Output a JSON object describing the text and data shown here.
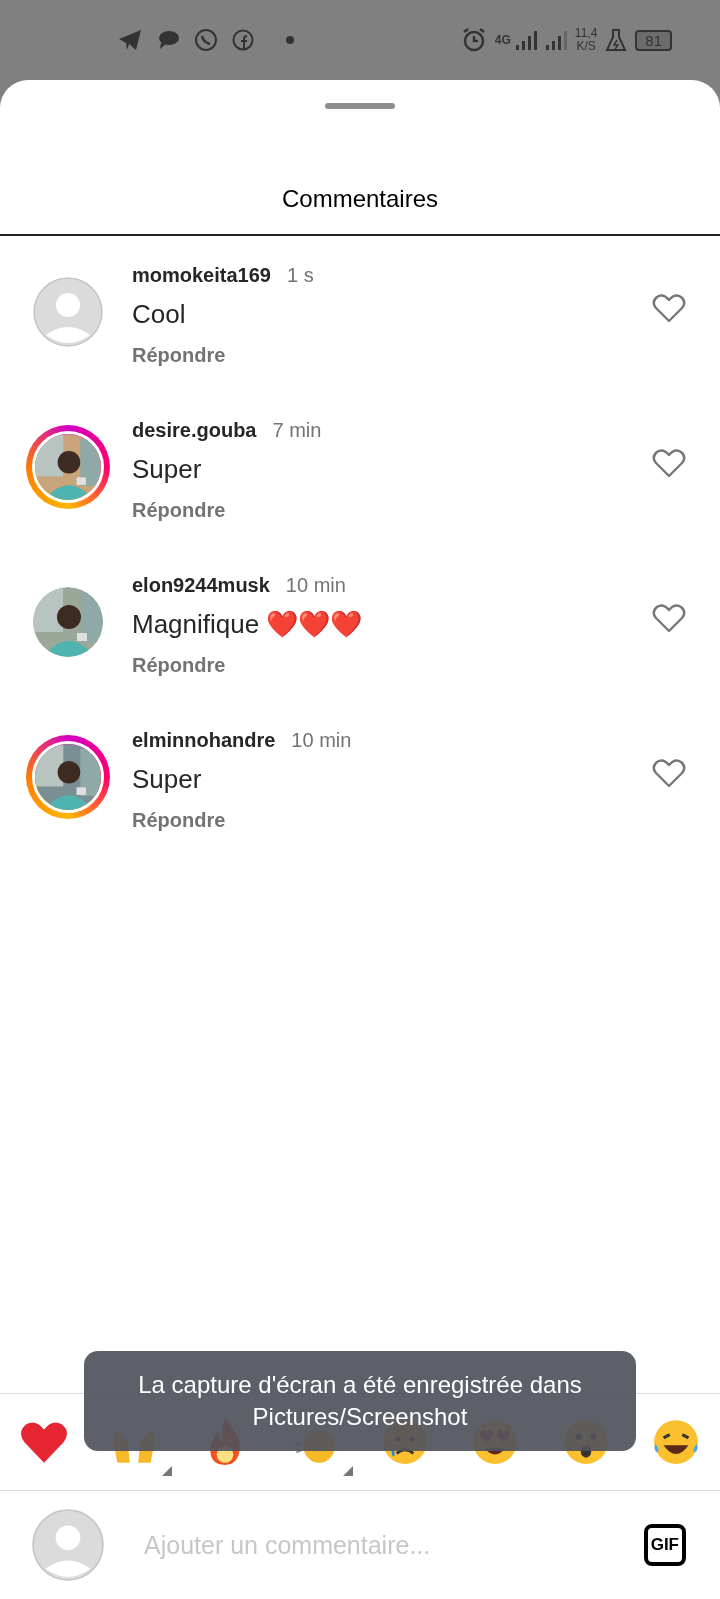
{
  "status_bar": {
    "network": "4G",
    "speed_value": "11,4",
    "speed_unit": "K/S",
    "battery": "81"
  },
  "sheet": {
    "title": "Commentaires"
  },
  "comments": [
    {
      "username": "momokeita169",
      "time": "1 s",
      "text": "Cool",
      "reply": "Répondre",
      "has_photo": false,
      "story_ring": false,
      "liked": false
    },
    {
      "username": "desire.gouba",
      "time": "7 min",
      "text": "Super",
      "reply": "Répondre",
      "has_photo": true,
      "story_ring": true,
      "liked": false
    },
    {
      "username": "elon9244musk",
      "time": "10 min",
      "text": "Magnifique ❤️❤️❤️",
      "reply": "Répondre",
      "has_photo": true,
      "story_ring": false,
      "liked": false
    },
    {
      "username": "elminnohandre",
      "time": "10 min",
      "text": "Super",
      "reply": "Répondre",
      "has_photo": true,
      "story_ring": true,
      "liked": false
    }
  ],
  "reactions": [
    {
      "kind": "heart",
      "variants": false
    },
    {
      "kind": "raised-hands",
      "variants": true
    },
    {
      "kind": "fire",
      "variants": false
    },
    {
      "kind": "clap",
      "variants": true
    },
    {
      "kind": "sad",
      "variants": false
    },
    {
      "kind": "heart-eyes",
      "variants": false
    },
    {
      "kind": "surprised",
      "variants": false
    },
    {
      "kind": "laughing",
      "variants": false
    }
  ],
  "toast": {
    "text": "La capture d'écran a été enregistrée dans Pictures/Screenshot"
  },
  "composer": {
    "placeholder": "Ajouter un commentaire...",
    "gif_label": "GIF"
  }
}
